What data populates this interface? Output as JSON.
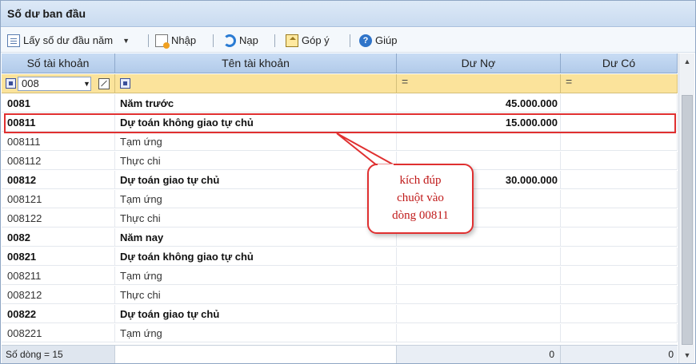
{
  "window": {
    "title": "Số dư ban đầu"
  },
  "toolbar": {
    "items": [
      {
        "label": "Lấy số dư đầu năm",
        "icon": "document-icon"
      },
      {
        "label": "Nhập",
        "icon": "import-icon"
      },
      {
        "label": "Nạp",
        "icon": "reload-icon"
      },
      {
        "label": "Góp ý",
        "icon": "feedback-icon"
      },
      {
        "label": "Giúp",
        "icon": "help-icon"
      }
    ]
  },
  "grid": {
    "columns": [
      "Số tài khoản",
      "Tên tài khoản",
      "Dư Nợ",
      "Dư Có"
    ],
    "filter": {
      "account_value": "008",
      "debit_operator": "=",
      "credit_operator": "="
    },
    "rows": [
      {
        "account": "0081",
        "name": "Năm trước",
        "debit": "45.000.000",
        "credit": "",
        "bold": true
      },
      {
        "account": "00811",
        "name": "Dự toán không giao tự chủ",
        "debit": "15.000.000",
        "credit": "",
        "bold": true
      },
      {
        "account": "008111",
        "name": "Tạm ứng",
        "debit": "",
        "credit": "",
        "bold": false
      },
      {
        "account": "008112",
        "name": "Thực chi",
        "debit": "",
        "credit": "",
        "bold": false
      },
      {
        "account": "00812",
        "name": "Dự toán giao tự chủ",
        "debit": "30.000.000",
        "credit": "",
        "bold": true
      },
      {
        "account": "008121",
        "name": "Tạm ứng",
        "debit": "",
        "credit": "",
        "bold": false
      },
      {
        "account": "008122",
        "name": "Thực chi",
        "debit": "",
        "credit": "",
        "bold": false
      },
      {
        "account": "0082",
        "name": "Năm nay",
        "debit": "",
        "credit": "",
        "bold": true
      },
      {
        "account": "00821",
        "name": "Dự toán không giao tự chủ",
        "debit": "",
        "credit": "",
        "bold": true
      },
      {
        "account": "008211",
        "name": "Tạm ứng",
        "debit": "",
        "credit": "",
        "bold": false
      },
      {
        "account": "008212",
        "name": "Thực chi",
        "debit": "",
        "credit": "",
        "bold": false
      },
      {
        "account": "00822",
        "name": "Dự toán giao tự chủ",
        "debit": "",
        "credit": "",
        "bold": true
      },
      {
        "account": "008221",
        "name": "Tạm ứng",
        "debit": "",
        "credit": "",
        "bold": false
      }
    ],
    "footer": {
      "row_count": "Số dòng = 15",
      "debit_total": "0",
      "credit_total": "0"
    }
  },
  "annotation": {
    "lines": [
      "kích đúp",
      "chuột vào",
      "dòng 00811"
    ],
    "color": "#e03030"
  }
}
